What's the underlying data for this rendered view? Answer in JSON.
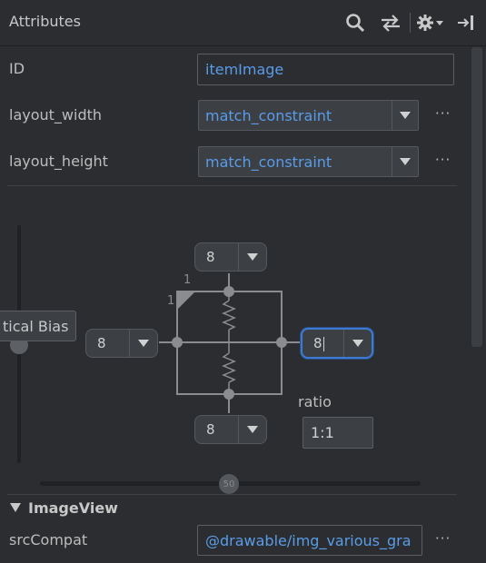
{
  "panel": {
    "title": "Attributes"
  },
  "header_icons": [
    "search-icon",
    "swap-icon",
    "gear-icon",
    "chevron-down-icon",
    "collapse-right-icon"
  ],
  "attributes": {
    "id": {
      "label": "ID",
      "value": "itemImage"
    },
    "layout_width": {
      "label": "layout_width",
      "value": "match_constraint",
      "more": "···"
    },
    "layout_height": {
      "label": "layout_height",
      "value": "match_constraint",
      "more": "···"
    }
  },
  "constraint_widget": {
    "top_margin": "8",
    "bottom_margin": "8",
    "left_margin": "8",
    "right_margin": "8",
    "ratio_label": "ratio",
    "ratio_value": "1:1",
    "ratio_marker_top": "1",
    "ratio_marker_left": "1",
    "vertical_bias_tooltip": "tical Bias",
    "horizontal_bias_value": "50"
  },
  "image_view": {
    "section_title": "ImageView",
    "src_label": "srcCompat",
    "src_value": "@drawable/img_various_gra",
    "more": "···"
  },
  "colors": {
    "background": "#2b2d30",
    "accent": "#5a9ce8",
    "focus": "#3d7ad1"
  }
}
